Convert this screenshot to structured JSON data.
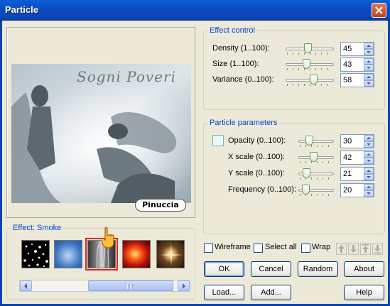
{
  "window": {
    "title": "Particle"
  },
  "preview": {
    "image_text": "Sogni Poveri",
    "signature": "Pinuccia"
  },
  "effect_group": {
    "label": "Effect: Smoke",
    "thumbnails": [
      "stars",
      "clouds",
      "smoke",
      "fire",
      "sparkle"
    ],
    "selected": "smoke"
  },
  "effect_control": {
    "label": "Effect control",
    "rows": [
      {
        "label": "Density (1..100):",
        "value": "45",
        "fraction": 0.45
      },
      {
        "label": "Size (1..100):",
        "value": "43",
        "fraction": 0.43
      },
      {
        "label": "Variance (0..100):",
        "value": "58",
        "fraction": 0.58
      }
    ]
  },
  "particle_params": {
    "label": "Particle parameters",
    "rows": [
      {
        "label": "Opacity (0..100):",
        "value": "30",
        "fraction": 0.3
      },
      {
        "label": "X scale (0..100):",
        "value": "42",
        "fraction": 0.42
      },
      {
        "label": "Y scale (0..100):",
        "value": "21",
        "fraction": 0.21
      },
      {
        "label": "Frequency (0..100):",
        "value": "20",
        "fraction": 0.2
      }
    ]
  },
  "options": {
    "wireframe": "Wireframe",
    "select_all": "Select all",
    "wrap": "Wrap"
  },
  "buttons": {
    "ok": "OK",
    "cancel": "Cancel",
    "random": "Random",
    "about": "About",
    "load": "Load...",
    "add": "Add...",
    "help": "Help"
  },
  "colors": {
    "title_bar": "#0a4fc4",
    "group_label": "#0046d5",
    "selection": "#d9262a"
  }
}
